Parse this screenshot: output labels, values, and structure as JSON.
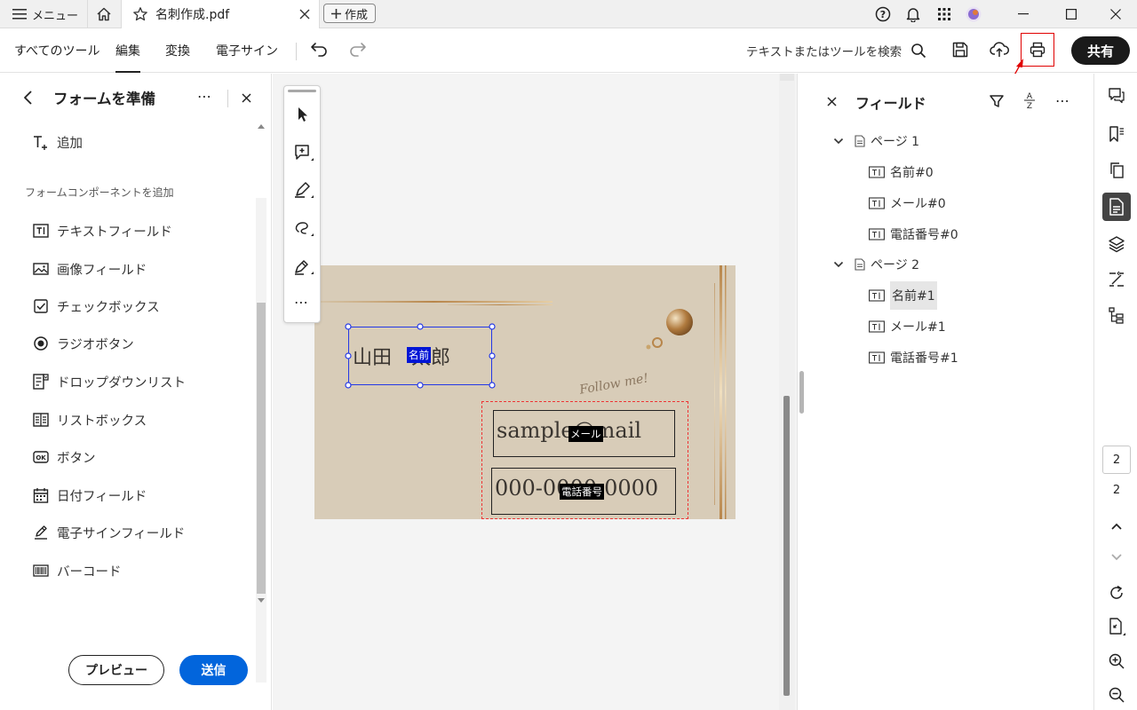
{
  "titlebar": {
    "menu_label": "メニュー",
    "tab_title": "名刺作成.pdf",
    "create_label": "作成",
    "avatar_color": "#e07a3a"
  },
  "toolbar": {
    "tabs": [
      "すべてのツール",
      "編集",
      "変換",
      "電子サイン"
    ],
    "active_tab": "編集",
    "search_placeholder": "テキストまたはツールを検索",
    "share_label": "共有",
    "highlight_color": "#e00000"
  },
  "left_panel": {
    "title": "フォームを準備",
    "add_label": "追加",
    "section_title": "フォームコンポーネントを追加",
    "items": [
      {
        "label": "テキストフィールド",
        "icon": "text-field-icon"
      },
      {
        "label": "画像フィールド",
        "icon": "image-field-icon"
      },
      {
        "label": "チェックボックス",
        "icon": "checkbox-icon"
      },
      {
        "label": "ラジオボタン",
        "icon": "radio-button-icon"
      },
      {
        "label": "ドロップダウンリスト",
        "icon": "dropdown-list-icon"
      },
      {
        "label": "リストボックス",
        "icon": "list-box-icon"
      },
      {
        "label": "ボタン",
        "icon": "ok-button-icon"
      },
      {
        "label": "日付フィールド",
        "icon": "date-field-icon"
      },
      {
        "label": "電子サインフィールド",
        "icon": "signature-field-icon"
      },
      {
        "label": "バーコード",
        "icon": "barcode-icon"
      }
    ],
    "preview_label": "プレビュー",
    "send_label": "送信",
    "accent": "#0265dc"
  },
  "card": {
    "name_value": "山田　太郎",
    "name_tag": "名前",
    "email_value": "sample@mail",
    "email_tag": "メール",
    "phone_value": "000-0000-0000",
    "phone_tag": "電話番号",
    "script_text": "Follow me!",
    "bg_color": "#d8ccb8",
    "gold_color": "#b8864b"
  },
  "right_panel": {
    "title": "フィールド",
    "pages": [
      {
        "label": "ページ 1",
        "fields": [
          "名前#0",
          "メール#0",
          "電話番号#0"
        ]
      },
      {
        "label": "ページ 2",
        "fields": [
          "名前#1",
          "メール#1",
          "電話番号#1"
        ]
      }
    ],
    "selected_field": "名前#1"
  },
  "right_rail": {
    "page_input": "2",
    "page_total": "2"
  }
}
